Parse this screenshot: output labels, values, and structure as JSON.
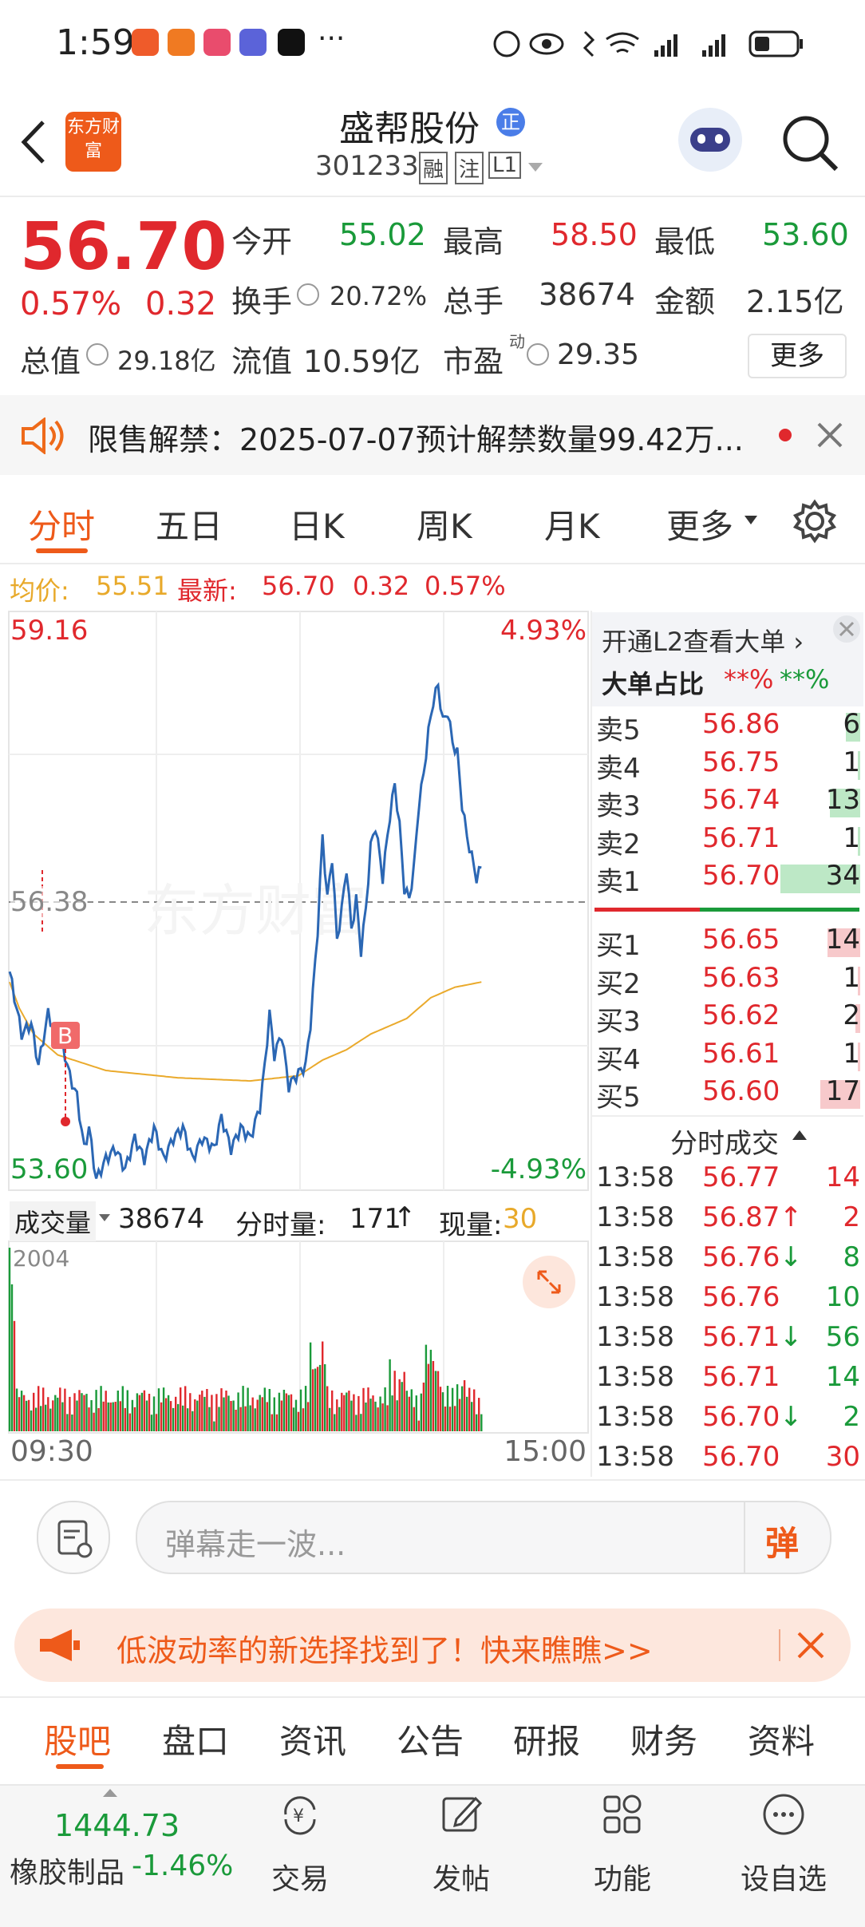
{
  "status": {
    "time": "1:59",
    "more": "···"
  },
  "header": {
    "logo": "东方财富",
    "title": "盛帮股份",
    "badge": "正",
    "code": "301233",
    "tags": [
      "融",
      "注",
      "L1"
    ]
  },
  "quote": {
    "price": "56.70",
    "change_pct": "0.57%",
    "change": "0.32",
    "open_label": "今开",
    "open": "55.02",
    "high_label": "最高",
    "high": "58.50",
    "low_label": "最低",
    "low": "53.60",
    "turnover_label": "换手",
    "turnover": "20.72%",
    "volume_label": "总手",
    "volume": "38674",
    "amount_label": "金额",
    "amount": "2.15亿",
    "mcap_label": "总值",
    "mcap": "29.18亿",
    "float_label": "流值",
    "float": "10.59亿",
    "pe_label": "市盈",
    "pe_sup": "动",
    "pe": "29.35",
    "more": "更多"
  },
  "notice": {
    "text": "限售解禁：2025-07-07预计解禁数量99.42万..."
  },
  "tabs": [
    "分时",
    "五日",
    "日K",
    "周K",
    "月K",
    "更多"
  ],
  "legend": {
    "avg_label": "均价:",
    "avg": "55.51",
    "latest_label": "最新:",
    "latest": "56.70",
    "chg": "0.32",
    "pct": "0.57%"
  },
  "chart": {
    "ymax": "59.16",
    "ymin": "53.60",
    "pmax": "4.93%",
    "pmin": "-4.93%",
    "mid": "56.38",
    "marker": "B",
    "watermark": "东方财富",
    "t_start": "09:30",
    "t_end": "15:00",
    "vol_max": "2004"
  },
  "vol_bar": {
    "label": "成交量",
    "total": "38674",
    "tick_label": "分时量:",
    "tick": "171",
    "tick_arrow": "↑",
    "now_label": "现量:",
    "now": "30"
  },
  "l2": {
    "link": "开通L2查看大单 ›",
    "big_label": "大单占比",
    "big_red": "**%",
    "big_green": "**%"
  },
  "asks": [
    {
      "k": "卖5",
      "p": "56.86",
      "v": "6"
    },
    {
      "k": "卖4",
      "p": "56.75",
      "v": "1"
    },
    {
      "k": "卖3",
      "p": "56.74",
      "v": "13"
    },
    {
      "k": "卖2",
      "p": "56.71",
      "v": "1"
    },
    {
      "k": "卖1",
      "p": "56.70",
      "v": "34"
    }
  ],
  "bids": [
    {
      "k": "买1",
      "p": "56.65",
      "v": "14"
    },
    {
      "k": "买2",
      "p": "56.63",
      "v": "1"
    },
    {
      "k": "买3",
      "p": "56.62",
      "v": "2"
    },
    {
      "k": "买4",
      "p": "56.61",
      "v": "1"
    },
    {
      "k": "买5",
      "p": "56.60",
      "v": "17"
    }
  ],
  "trades_title": "分时成交",
  "trades": [
    {
      "t": "13:58",
      "p": "56.77",
      "a": "",
      "v": "14",
      "c": "red"
    },
    {
      "t": "13:58",
      "p": "56.87",
      "a": "↑",
      "v": "2",
      "c": "red"
    },
    {
      "t": "13:58",
      "p": "56.76",
      "a": "↓",
      "v": "8",
      "c": "green"
    },
    {
      "t": "13:58",
      "p": "56.76",
      "a": "",
      "v": "10",
      "c": "green"
    },
    {
      "t": "13:58",
      "p": "56.71",
      "a": "↓",
      "v": "56",
      "c": "green"
    },
    {
      "t": "13:58",
      "p": "56.71",
      "a": "",
      "v": "14",
      "c": "green"
    },
    {
      "t": "13:58",
      "p": "56.70",
      "a": "↓",
      "v": "2",
      "c": "green"
    },
    {
      "t": "13:58",
      "p": "56.70",
      "a": "",
      "v": "30",
      "c": "red"
    }
  ],
  "comment": {
    "placeholder": "弹幕走一波...",
    "danmu": "弹"
  },
  "ad": {
    "text": "低波动率的新选择找到了！快来瞧瞧>>"
  },
  "bottom_tabs": [
    "股吧",
    "盘口",
    "资讯",
    "公告",
    "研报",
    "财务",
    "资料"
  ],
  "index": {
    "value": "1444.73",
    "name": "橡胶制品",
    "pct": "-1.46%"
  },
  "nav": [
    "交易",
    "发帖",
    "功能",
    "设自选"
  ],
  "colors": {
    "up": "#e0282d",
    "down": "#1a9a3a",
    "accent": "#ee6a1a",
    "price_line": "#2b67b4",
    "avg_line": "#eaaa2c"
  }
}
